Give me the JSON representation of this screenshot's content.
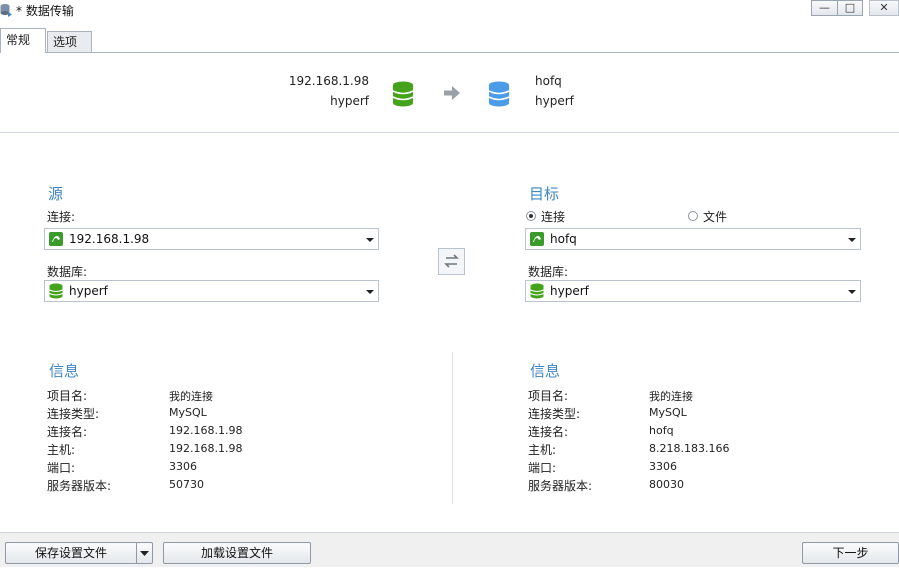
{
  "window": {
    "title": "* 数据传输",
    "buttons": {
      "minimize": "—",
      "maximize": "□",
      "close": "✕"
    }
  },
  "tabs": [
    {
      "label": "常规",
      "active": true
    },
    {
      "label": "选项",
      "active": false
    }
  ],
  "summary": {
    "source_host": "192.168.1.98",
    "source_db": "hyperf",
    "target_host": "hofq",
    "target_db": "hyperf",
    "source_icon_color": "#45a31b",
    "target_icon_color": "#4a9be8"
  },
  "source": {
    "title": "源",
    "connection_label": "连接:",
    "connection_value": "192.168.1.98",
    "database_label": "数据库:",
    "database_value": "hyperf"
  },
  "target": {
    "title": "目标",
    "radio_connection": "连接",
    "radio_file": "文件",
    "selected_mode": "connection",
    "connection_value": "hofq",
    "database_label": "数据库:",
    "database_value": "hyperf"
  },
  "source_info": {
    "title": "信息",
    "rows": [
      {
        "key": "项目名:",
        "value": "我的连接"
      },
      {
        "key": "连接类型:",
        "value": "MySQL"
      },
      {
        "key": "连接名:",
        "value": "192.168.1.98"
      },
      {
        "key": "主机:",
        "value": "192.168.1.98"
      },
      {
        "key": "端口:",
        "value": "3306"
      },
      {
        "key": "服务器版本:",
        "value": "50730"
      }
    ]
  },
  "target_info": {
    "title": "信息",
    "rows": [
      {
        "key": "项目名:",
        "value": "我的连接"
      },
      {
        "key": "连接类型:",
        "value": "MySQL"
      },
      {
        "key": "连接名:",
        "value": "hofq"
      },
      {
        "key": "主机:",
        "value": "8.218.183.166"
      },
      {
        "key": "端口:",
        "value": "3306"
      },
      {
        "key": "服务器版本:",
        "value": "80030"
      }
    ]
  },
  "footer": {
    "save_label": "保存设置文件",
    "load_label": "加载设置文件",
    "next_label": "下一步"
  },
  "colors": {
    "accent": "#3f86c2",
    "db_green": "#45a31b",
    "db_blue": "#4a9be8"
  }
}
